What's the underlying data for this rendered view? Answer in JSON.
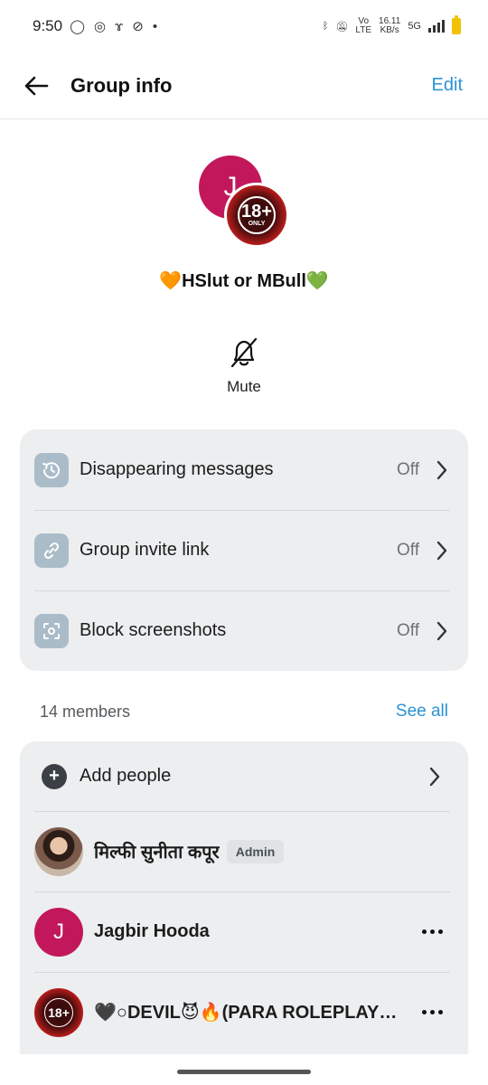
{
  "status_bar": {
    "time": "9:50",
    "network_label": "5G",
    "speed_value": "16.11",
    "speed_unit": "KB/s",
    "volte_top": "Vo",
    "volte_bottom": "LTE"
  },
  "header": {
    "title": "Group info",
    "edit_label": "Edit",
    "back_icon": "arrow-left-icon"
  },
  "group": {
    "avatar_letter": "J",
    "badge_text": "18+",
    "badge_sub": "ONLY",
    "name": "🧡HSlut or MBull💚",
    "mute_label": "Mute"
  },
  "settings": {
    "items": [
      {
        "label": "Disappearing messages",
        "value": "Off",
        "icon": "timer-icon"
      },
      {
        "label": "Group invite link",
        "value": "Off",
        "icon": "link-icon"
      },
      {
        "label": "Block screenshots",
        "value": "Off",
        "icon": "screenshot-icon"
      }
    ]
  },
  "members": {
    "count_label": "14 members",
    "see_all_label": "See all",
    "add_label": "Add people",
    "list": [
      {
        "name": "मिल्फी सुनीता कपूर",
        "badge": "Admin"
      },
      {
        "name": "Jagbir Hooda",
        "avatar_letter": "J"
      },
      {
        "name": "🖤○DEVIL😈🔥(PARA ROLEPLAYER)🔥",
        "avatar_text": "18+"
      }
    ]
  },
  "colors": {
    "accent": "#2a93d5",
    "avatar_pink": "#c2185b",
    "card_bg": "#eceef0"
  }
}
